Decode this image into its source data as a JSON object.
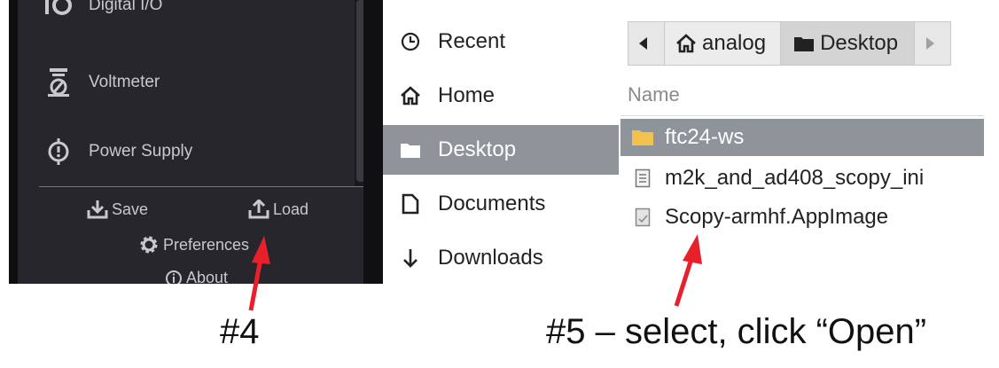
{
  "sidebar": {
    "tools": [
      {
        "label": "Digital I/O",
        "icon": "digital-io-icon"
      },
      {
        "label": "Voltmeter",
        "icon": "voltmeter-icon"
      },
      {
        "label": "Power Supply",
        "icon": "power-supply-icon"
      }
    ],
    "save_label": "Save",
    "load_label": "Load",
    "preferences_label": "Preferences",
    "about_label": "About"
  },
  "file_dialog": {
    "places": [
      {
        "label": "Recent",
        "icon": "clock-icon"
      },
      {
        "label": "Home",
        "icon": "home-icon"
      },
      {
        "label": "Desktop",
        "icon": "folder-icon",
        "active": true
      },
      {
        "label": "Documents",
        "icon": "document-icon"
      },
      {
        "label": "Downloads",
        "icon": "download-arrow-icon"
      }
    ],
    "breadcrumb": [
      "analog",
      "Desktop"
    ],
    "column_header": "Name",
    "files": [
      {
        "name": "ftc24-ws",
        "type": "folder",
        "selected": true
      },
      {
        "name": "m2k_and_ad408_scopy_ini",
        "type": "text-file"
      },
      {
        "name": "Scopy-armhf.AppImage",
        "type": "app-image"
      }
    ]
  },
  "annotations": {
    "step4": "#4",
    "step5": "#5 – select, click “Open”"
  },
  "colors": {
    "dark_panel": "#26262c",
    "selection": "#8e949a",
    "arrow": "#e8202a"
  }
}
